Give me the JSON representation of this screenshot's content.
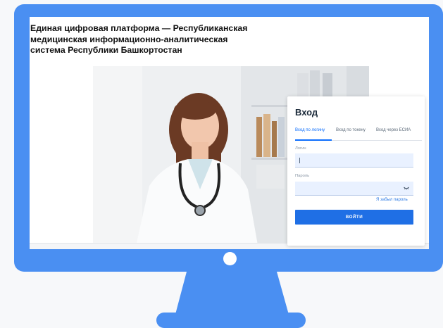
{
  "header": {
    "title_line1": "Единая цифровая платформа — Республиканская",
    "title_line2": "медицинская информационно-аналитическая",
    "title_line3": "система Республики Башкортостан"
  },
  "login": {
    "title": "Вход",
    "tabs": [
      {
        "label": "Вход по логину",
        "active": true
      },
      {
        "label": "Вход по токену",
        "active": false
      },
      {
        "label": "Вход через ЕСИА",
        "active": false
      }
    ],
    "login_label": "Логин",
    "login_value": "",
    "password_label": "Пароль",
    "password_value": "",
    "forgot_label": "Я забыл пароль",
    "submit_label": "ВОЙТИ"
  },
  "colors": {
    "monitor": "#4a8ff2",
    "accent": "#1f6fe5",
    "field_bg": "#e9f1ff"
  },
  "icons": {
    "password_toggle": "eye-icon",
    "camera": "camera-dot-icon"
  }
}
